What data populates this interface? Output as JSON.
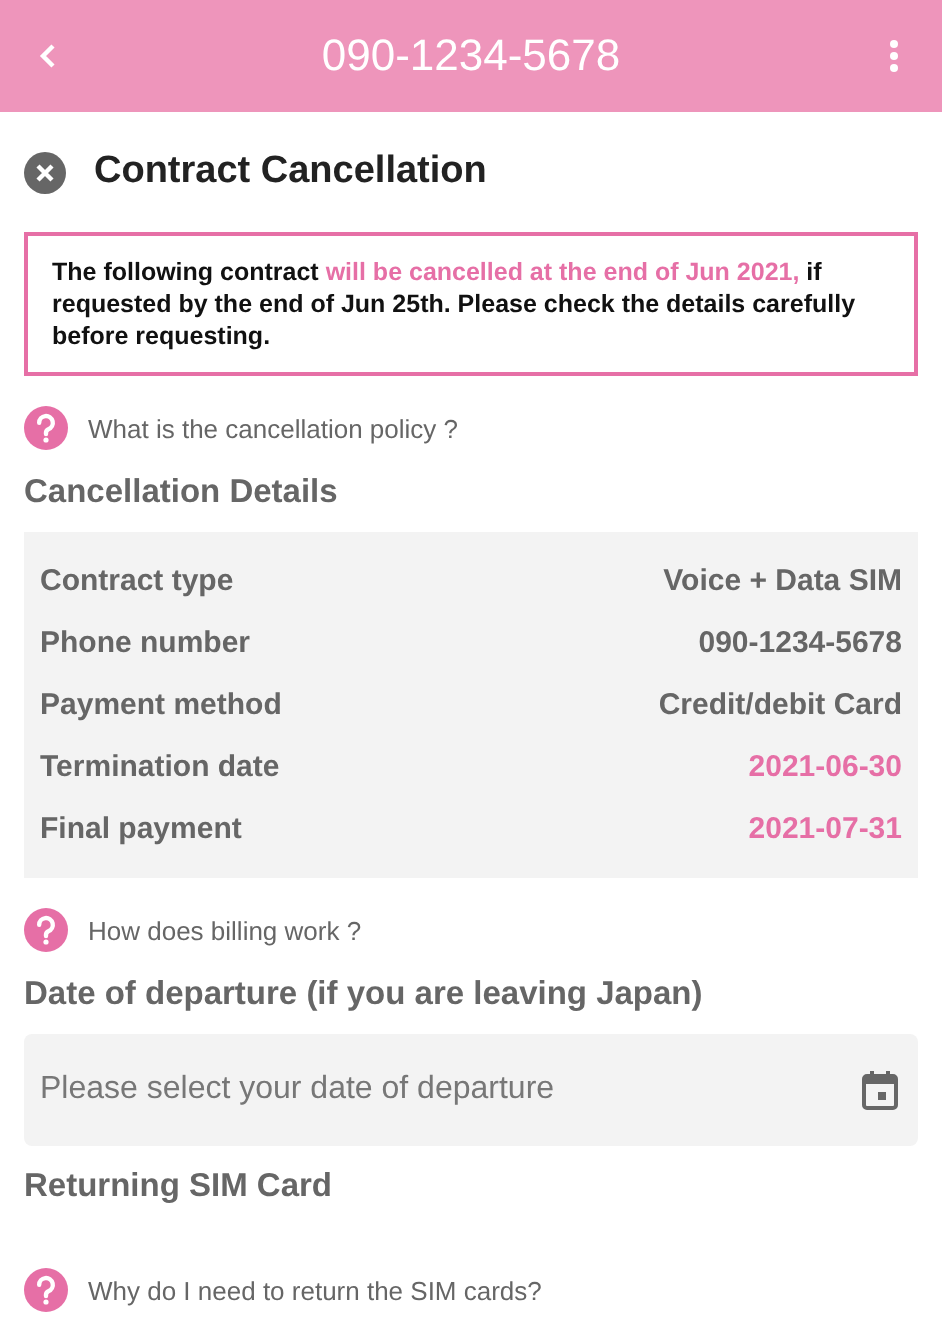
{
  "app_bar": {
    "title": "090-1234-5678"
  },
  "page_title": "Contract Cancellation",
  "notice": [
    {
      "text": "The following contract ",
      "highlight": false
    },
    {
      "text": "will be cancelled at the end of Jun 2021,",
      "highlight": true
    },
    {
      "text": " if requested by the end of Jun 25th. Please check the details carefully before requesting.",
      "highlight": false
    }
  ],
  "help_cancellation": "What is the cancellation policy ?",
  "details": {
    "heading": "Cancellation Details",
    "rows": [
      {
        "label": "Contract type",
        "value": "Voice + Data SIM",
        "highlight": false
      },
      {
        "label": "Phone number",
        "value": "090-1234-5678",
        "highlight": false
      },
      {
        "label": "Payment method",
        "value": "Credit/debit Card",
        "highlight": false
      },
      {
        "label": "Termination date",
        "value": "2021-06-30",
        "highlight": true
      },
      {
        "label": "Final payment",
        "value": "2021-07-31",
        "highlight": true
      }
    ]
  },
  "help_billing": "How does billing work ?",
  "departure": {
    "heading": "Date of departure (if you are leaving Japan)",
    "placeholder": "Please select your date of departure"
  },
  "sim_return": {
    "heading": "Returning SIM Card",
    "help": "Why do I need to return the SIM cards?"
  }
}
